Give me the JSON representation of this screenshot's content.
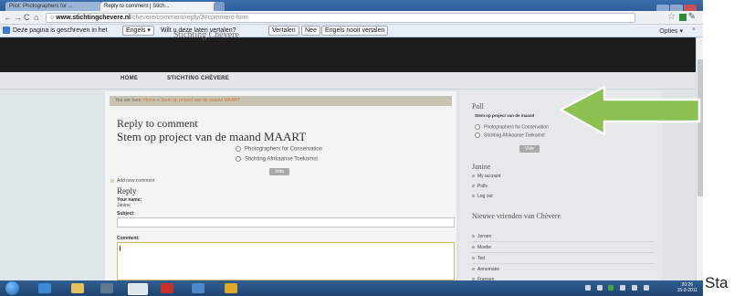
{
  "browser": {
    "tabs": [
      {
        "label": "Pilot: Photographers for ..."
      },
      {
        "label": "Reply to comment | Stich..."
      }
    ],
    "url_domain": "www.stichtingchevere.nl",
    "url_path": "/chevere/comment/reply/3#comment-form"
  },
  "translate_bar": {
    "message": "Deze pagina is geschreven in het",
    "language": "Engels",
    "question": "Wilt u deze laten vertalen?",
    "translate_button": "Vertalen",
    "no_button": "Nee",
    "never_button": "Engels nooit vertalen",
    "options": "Opties",
    "close": "×"
  },
  "site": {
    "title": "Stichting Chèvere",
    "nav": [
      "HOME",
      "STICHTING CHÈVERE"
    ]
  },
  "main": {
    "breadcrumb_prefix": "You are here:",
    "breadcrumb_link": "Home",
    "breadcrumb_sep": "»",
    "breadcrumb_current": "Stem op project van de maand MAART",
    "heading1": "Reply to comment",
    "heading2": "Stem op project van de maand MAART",
    "poll_options": [
      "Photographers for Conservation",
      "Stichting Afrikaanse Toekomst"
    ],
    "vote_button": "Vote",
    "add_comment": "Add new comment",
    "reply_heading": "Reply",
    "your_name_label": "Your name:",
    "your_name_value": "Janine",
    "subject_label": "Subject:",
    "comment_label": "Comment:"
  },
  "sidebar": {
    "poll_heading": "Poll",
    "poll_question": "Stem op project van de maand",
    "poll_options": [
      "Photographers for Conservation",
      "Stichting Afrikaanse Toekomst"
    ],
    "vote_button": "Vote",
    "user_heading": "Janine",
    "user_links": [
      "My account",
      "Polls",
      "Log out"
    ],
    "friends_heading": "Nieuwe vrienden van Chèvere",
    "friends": [
      "Jeroen",
      "Moeke",
      "Ted",
      "Annemarie",
      "Fransen"
    ]
  },
  "taskbar": {
    "time": "20:26",
    "date": "15-3-2011"
  },
  "overlay_text": "Sta",
  "colors": {
    "arrow": "#8cc152",
    "header": "#1d1d1d",
    "taskbar": "#2f5f92"
  }
}
